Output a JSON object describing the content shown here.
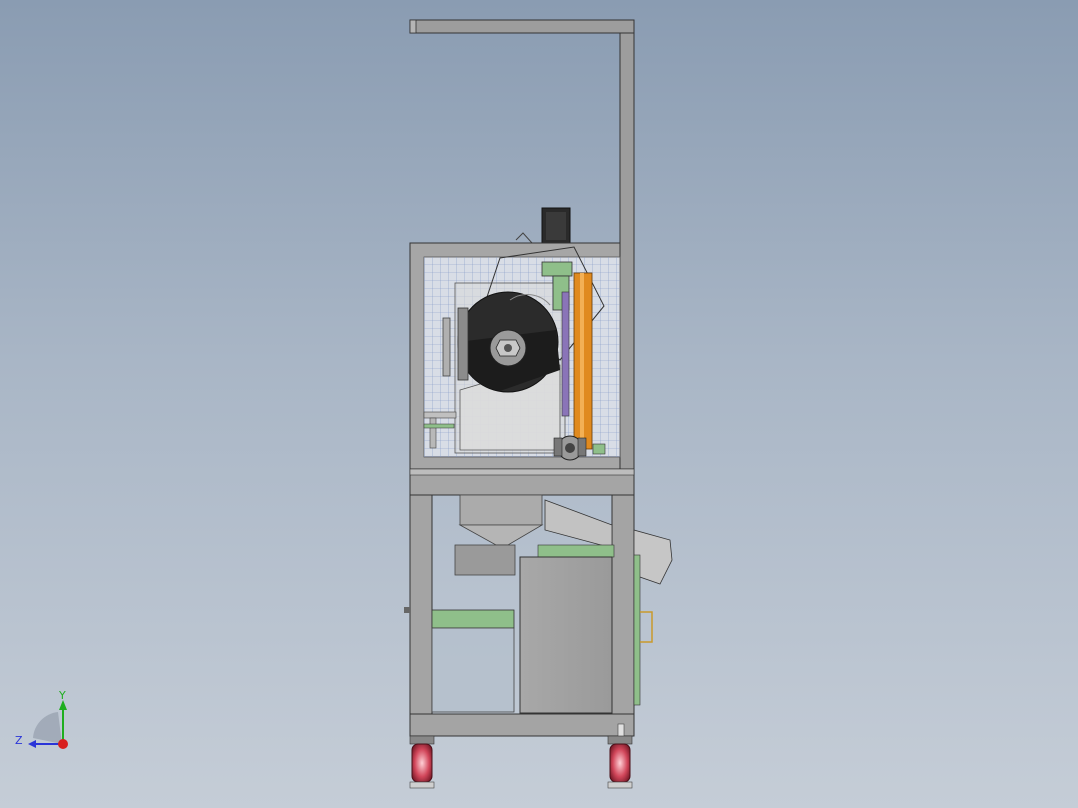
{
  "viewport": {
    "background_top": "#8a9cb2",
    "background_bottom": "#c5cdd7"
  },
  "triad": {
    "y_label": "Y",
    "z_label": "Z",
    "y_color": "#1fae1f",
    "z_color": "#2a35d8",
    "x_color": "#d81f1f"
  },
  "model": {
    "frame_color": "#9a9a9a",
    "mesh_color": "#7a94c8",
    "orange_part": "#e08a1f",
    "green_part": "#8fbf8a",
    "purple_part": "#8a74b8",
    "caster_color": "#c23a4c"
  }
}
